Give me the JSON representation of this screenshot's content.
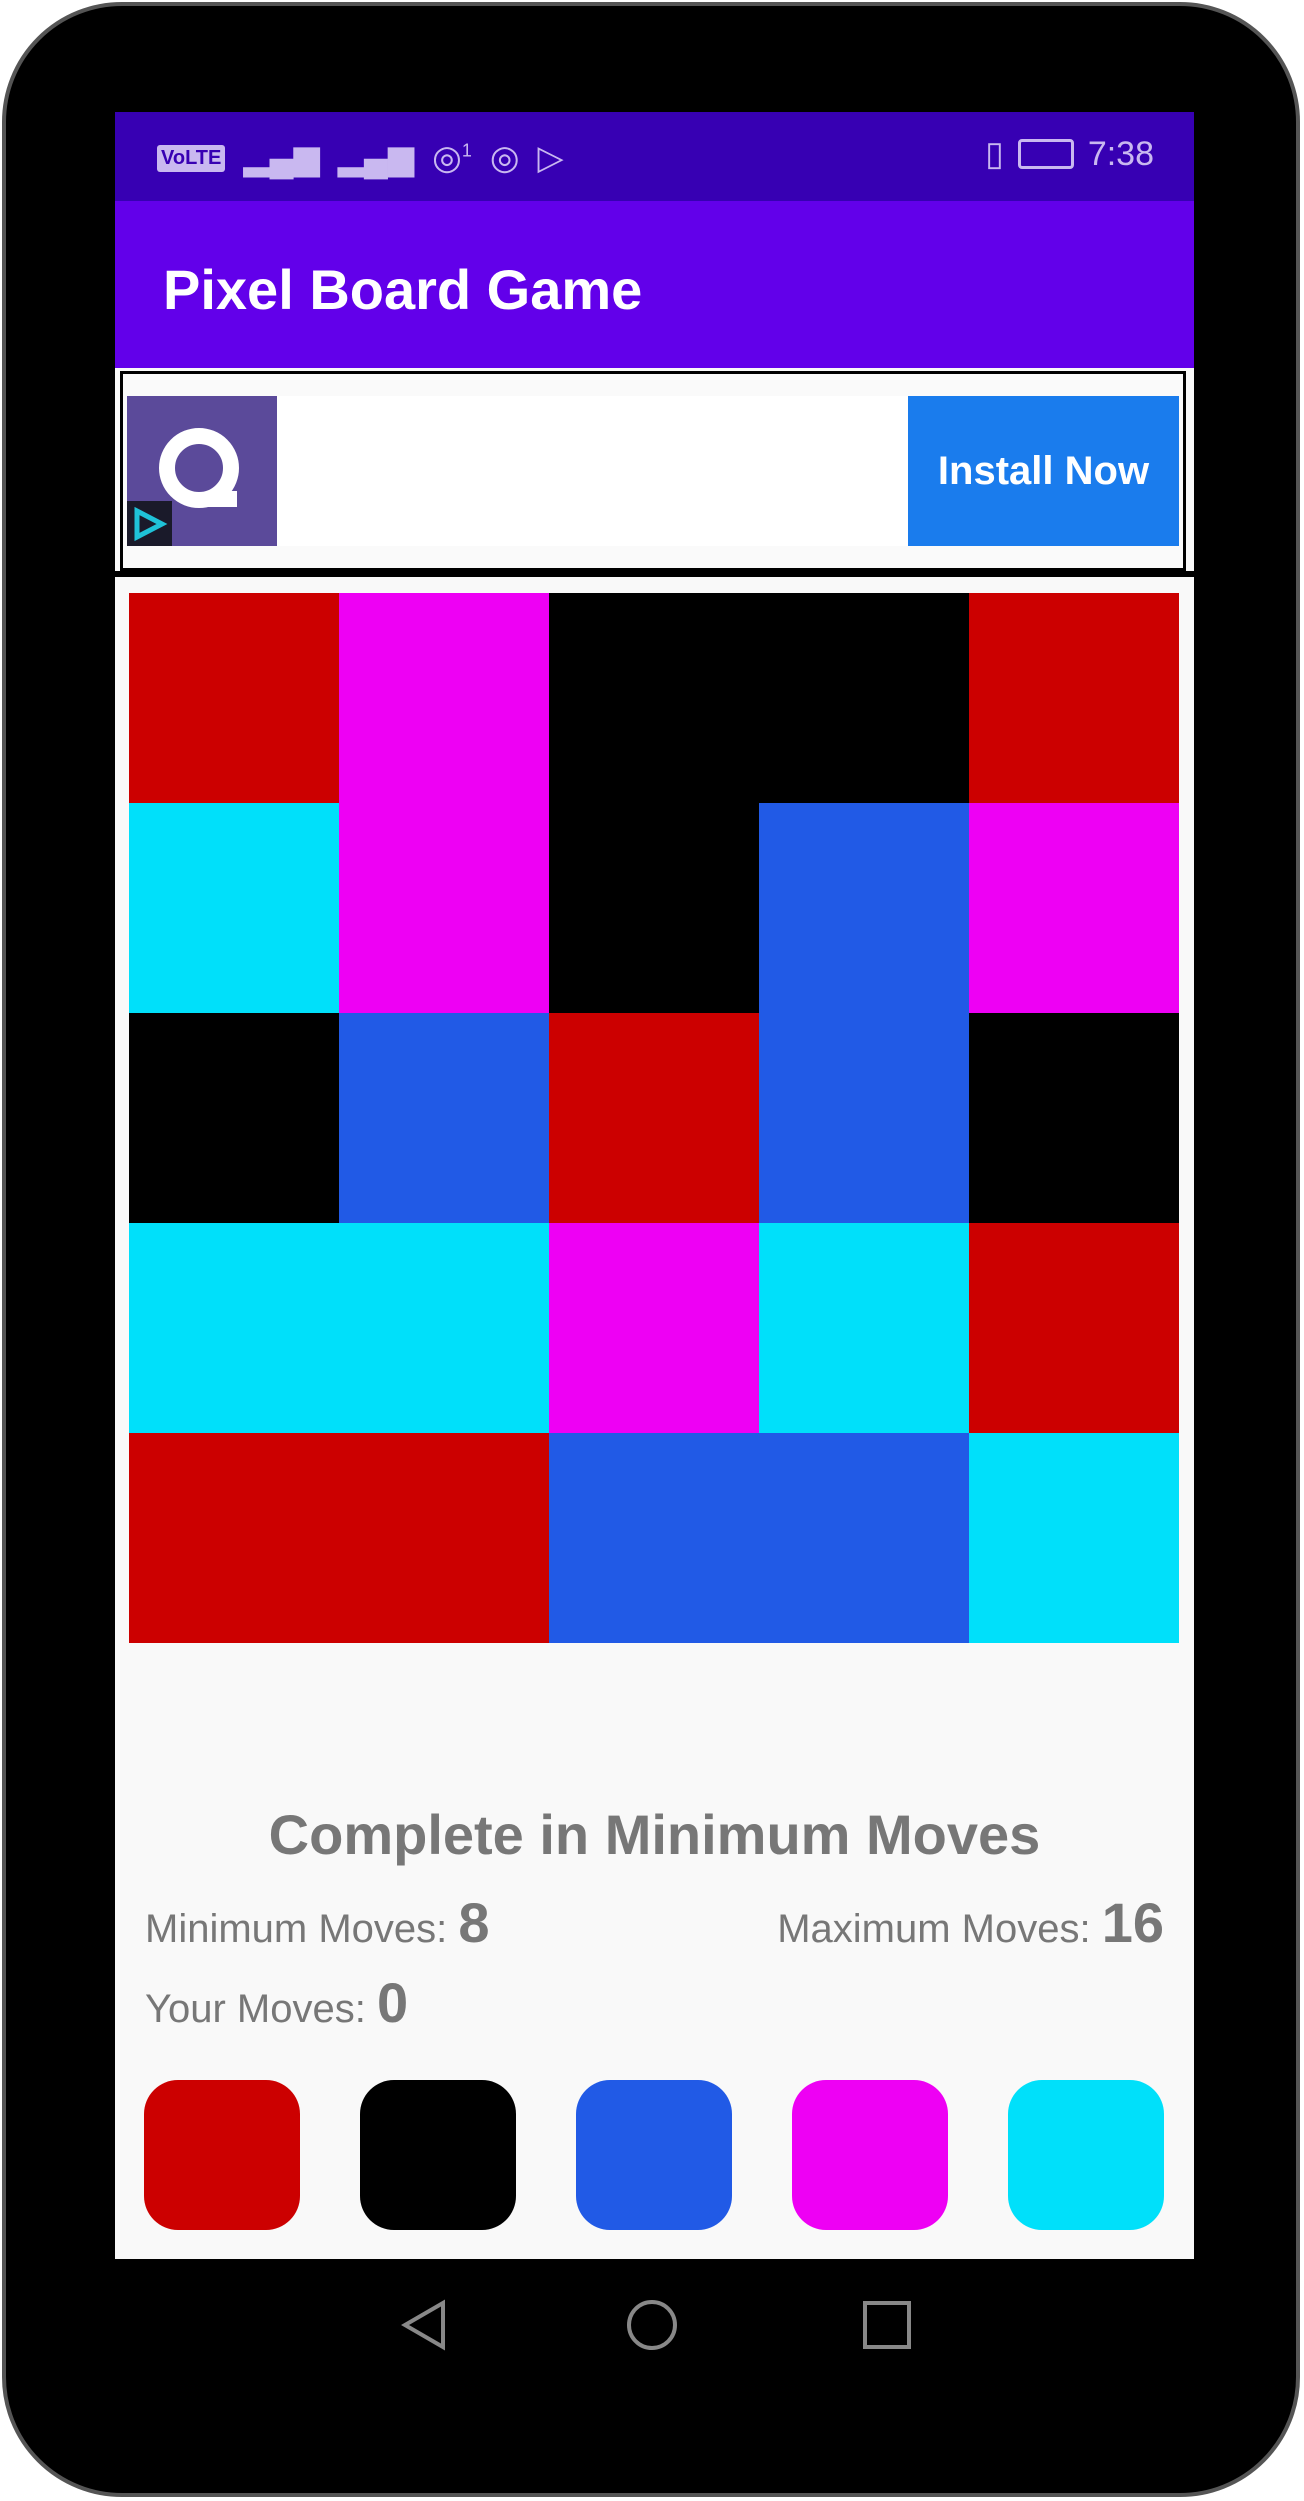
{
  "status_bar": {
    "left_icons": [
      "volte-icon",
      "signal-4g-icon",
      "signal-icon",
      "hotspot-icon",
      "nfc-icon",
      "play-icon"
    ],
    "hotspot_count": "1",
    "time": "7:38",
    "right_icons": [
      "vibrate-icon",
      "battery-charging-icon"
    ]
  },
  "app_bar": {
    "title": "Pixel Board Game"
  },
  "ad": {
    "cta": "Install Now",
    "logo_color": "#5b4a9a",
    "cta_color": "#1a7ced"
  },
  "palette": {
    "red": "#cc0000",
    "black": "#000000",
    "blue": "#215ae6",
    "magenta": "#ee00f4",
    "cyan": "#00e0fa"
  },
  "board": [
    [
      "red",
      "magenta",
      "black",
      "black",
      "red"
    ],
    [
      "cyan",
      "magenta",
      "black",
      "blue",
      "magenta"
    ],
    [
      "black",
      "blue",
      "red",
      "blue",
      "black"
    ],
    [
      "cyan",
      "cyan",
      "magenta",
      "cyan",
      "red"
    ],
    [
      "red",
      "red",
      "blue",
      "blue",
      "cyan"
    ]
  ],
  "game": {
    "goal": "Complete in Minimum Moves",
    "min_label": "Minimum Moves:",
    "min_value": "8",
    "max_label": "Maximum Moves:",
    "max_value": "16",
    "your_label": "Your Moves:",
    "your_value": "0"
  },
  "color_buttons": [
    "red",
    "black",
    "blue",
    "magenta",
    "cyan"
  ],
  "nav": [
    "back-icon",
    "home-icon",
    "recents-icon"
  ]
}
